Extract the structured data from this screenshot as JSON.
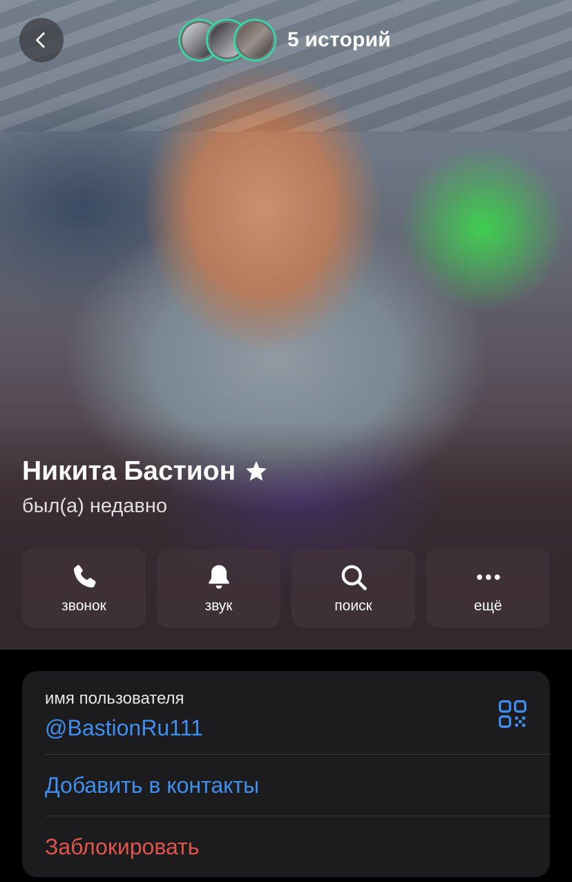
{
  "header": {
    "back_icon": "chevron-left-icon",
    "stories_label": "5 историй",
    "story_count": 3
  },
  "profile": {
    "name": "Никита Бастион",
    "badge_icon": "star-icon",
    "status": "был(а) недавно"
  },
  "actions": [
    {
      "label": "звонок",
      "icon": "phone-icon"
    },
    {
      "label": "звук",
      "icon": "bell-icon"
    },
    {
      "label": "поиск",
      "icon": "search-icon"
    },
    {
      "label": "ещё",
      "icon": "more-icon"
    }
  ],
  "info": {
    "username_caption": "имя пользователя",
    "username": "@BastionRu111",
    "qr_icon": "qr-code-icon",
    "add_contact": "Добавить в контакты",
    "block": "Заблокировать"
  },
  "colors": {
    "link": "#3e8ff0",
    "danger": "#e0544a",
    "story_ring": "#3bd3a0",
    "card_bg": "#1c1c1e"
  }
}
